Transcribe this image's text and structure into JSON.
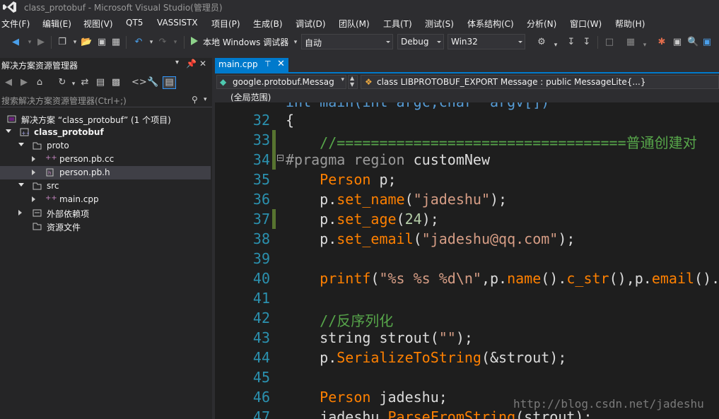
{
  "window": {
    "title": "class_protobuf - Microsoft Visual Studio(管理员)"
  },
  "menu": [
    "文件(F)",
    "编辑(E)",
    "视图(V)",
    "QT5",
    "VASSISTX",
    "项目(P)",
    "生成(B)",
    "调试(D)",
    "团队(M)",
    "工具(T)",
    "测试(S)",
    "体系结构(C)",
    "分析(N)",
    "窗口(W)",
    "帮助(H)"
  ],
  "toolbar": {
    "run_label": "本地 Windows 调试器",
    "config_combo": "自动",
    "build_config": "Debug",
    "platform": "Win32"
  },
  "solution_explorer": {
    "title": "解决方案资源管理器",
    "search_placeholder": "搜索解决方案资源管理器(Ctrl+;)",
    "items": [
      {
        "label": "解决方案 “class_protobuf” (1 个项目)"
      },
      {
        "label": "class_protobuf"
      },
      {
        "label": "proto"
      },
      {
        "label": "person.pb.cc"
      },
      {
        "label": "person.pb.h"
      },
      {
        "label": "src"
      },
      {
        "label": "main.cpp"
      },
      {
        "label": "外部依赖项"
      },
      {
        "label": "资源文件"
      }
    ]
  },
  "editor": {
    "tab": "main.cpp",
    "nav_file": "google.protobuf.Messag",
    "nav_member": "class LIBPROTOBUF_EXPORT Message : public MessageLite{...}",
    "scope": "(全局范围)",
    "line_numbers": [
      "32",
      "33",
      "34",
      "35",
      "36",
      "37",
      "38",
      "39",
      "40",
      "41",
      "42",
      "43",
      "44",
      "45",
      "46",
      "47"
    ],
    "lines": {
      "l31": "int main(int argc,char* argv[])",
      "l32": "{",
      "l33": "    //==================================普通创建对",
      "l34a": "#pragma region",
      "l34b": " customNew",
      "l35a": "    Person",
      "l35b": " p;",
      "l36a": "    p.",
      "l36b": "set_name",
      "l36c": "(",
      "l36d": "\"jadeshu\"",
      "l36e": ");",
      "l37a": "    p.",
      "l37b": "set_age",
      "l37c": "(",
      "l37d": "24",
      "l37e": ");",
      "l38a": "    p.",
      "l38b": "set_email",
      "l38c": "(",
      "l38d": "\"jadeshu@qq.com\"",
      "l38e": ");",
      "l40a": "    printf",
      "l40b": "(",
      "l40c": "\"%s %s %d\\n\"",
      "l40d": ",p.",
      "l40e": "name",
      "l40f": "().",
      "l40g": "c_str",
      "l40h": "(),p.",
      "l40i": "email",
      "l40j": "().",
      "l42": "    //反序列化",
      "l43a": "    string",
      "l43b": " strout(",
      "l43c": "\"\"",
      "l43d": ");",
      "l44a": "    p.",
      "l44b": "SerializeToString",
      "l44c": "(&strout);",
      "l46a": "    Person",
      "l46b": " jadeshu;",
      "l47a": "    jadeshu.",
      "l47b": "ParseFromString",
      "l47c": "(strout);"
    },
    "watermark": "http://blog.csdn.net/jadeshu"
  }
}
